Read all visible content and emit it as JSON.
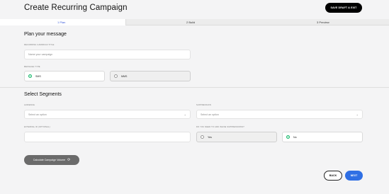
{
  "header": {
    "title": "Create Recurring Campaign",
    "save_label": "SAVE DRAFT & EXIT"
  },
  "steps": [
    {
      "num": "1",
      "label": "Plan",
      "active": true
    },
    {
      "num": "2",
      "label": "Build",
      "active": false
    },
    {
      "num": "3",
      "label": "Preview",
      "active": false
    }
  ],
  "plan": {
    "heading": "Plan your message",
    "title_label": "RECURRING CAMPAIGN TITLE",
    "title_placeholder": "Name your campaign",
    "type_label": "MESSAGE TYPE",
    "type_options": [
      "SMS",
      "MMS"
    ],
    "type_selected": "SMS"
  },
  "segments": {
    "heading": "Select Segments",
    "audience_label": "AUDIENCE",
    "audience_placeholder": "Select an option",
    "suppression_label": "SUPPRESSION",
    "suppression_placeholder": "Select an option",
    "external_label": "EXTERNAL ID (OPTIONAL)",
    "inline_label": "DO YOU NEED TO ADD INLINE SUPPRESSIONS?",
    "inline_options": [
      "Yes",
      "No"
    ],
    "inline_selected": "No"
  },
  "actions": {
    "calc_label": "Calculate Campaign Volume",
    "back_label": "BACK",
    "next_label": "NEXT"
  },
  "colors": {
    "accent": "#2f6fe4",
    "selected_radio": "#14b86a"
  }
}
